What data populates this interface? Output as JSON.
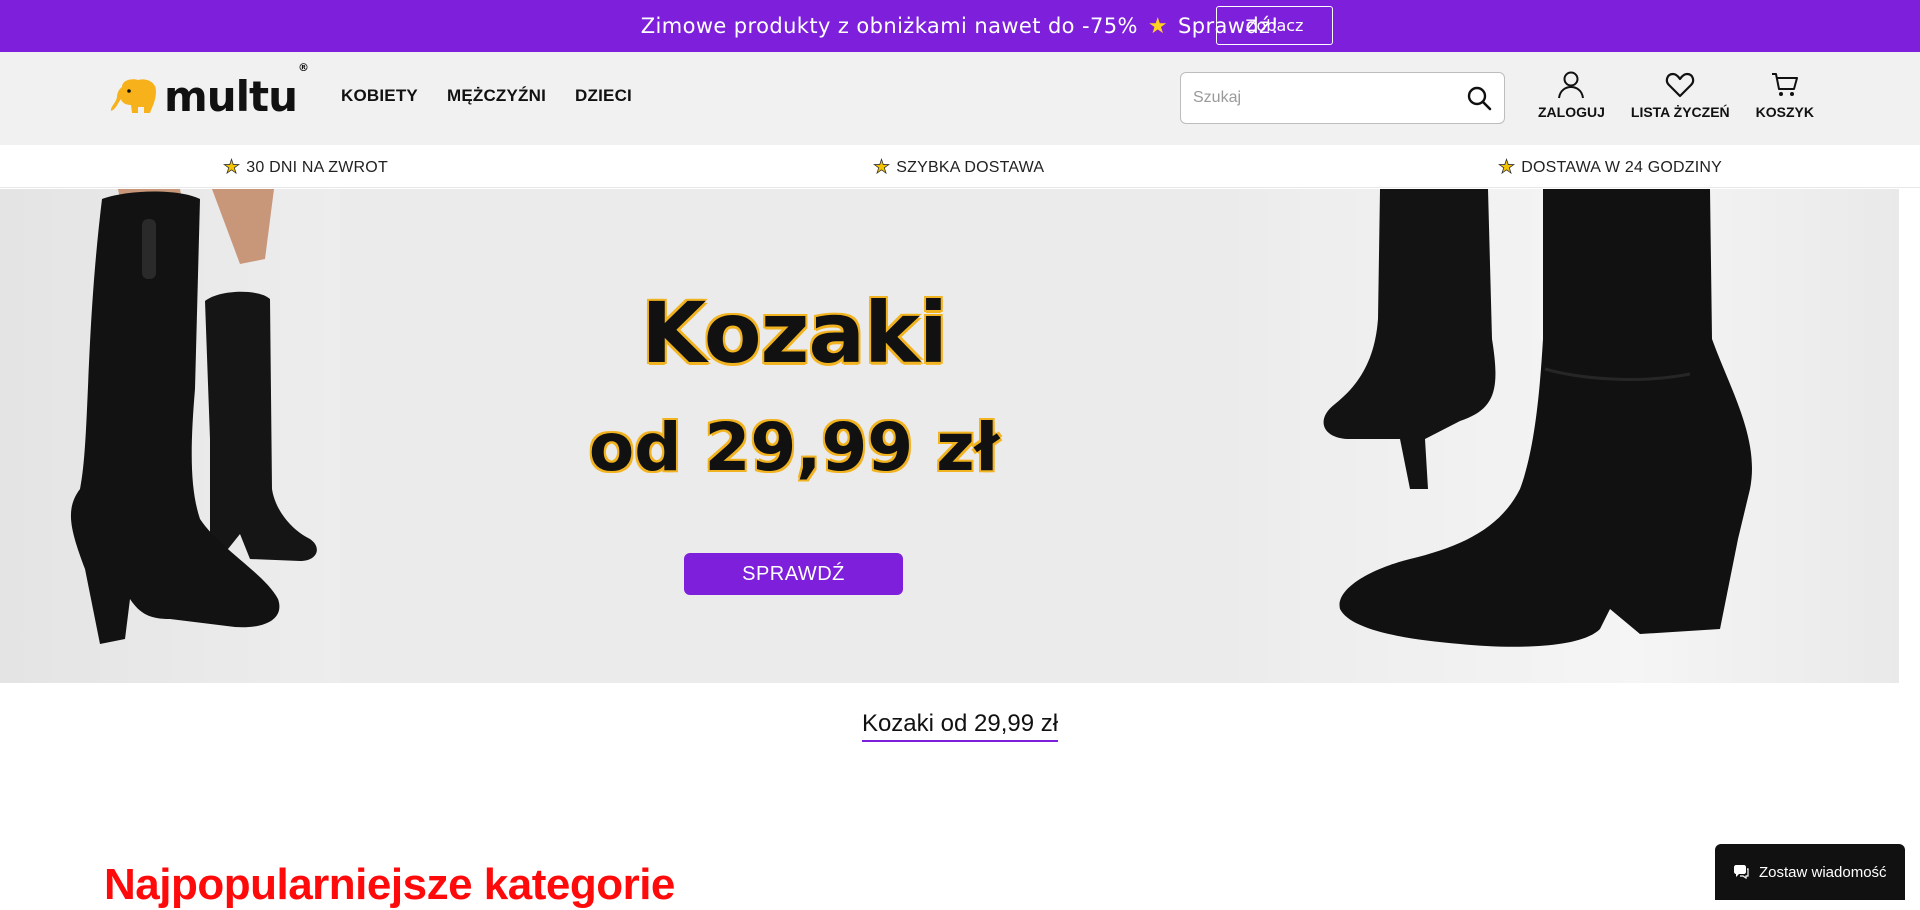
{
  "promo": {
    "text_before": "Zimowe produkty z obniżkami nawet do -75%",
    "text_after": "Sprawdź!",
    "button_label": "Zobacz"
  },
  "header": {
    "logo_text": "multu",
    "logo_mark": "®",
    "nav": [
      "KOBIETY",
      "MĘŻCZYŹNI",
      "DZIECI"
    ],
    "search_placeholder": "Szukaj",
    "actions": {
      "login": "ZALOGUJ",
      "wishlist": "LISTA ŻYCZEŃ",
      "cart": "KOSZYK"
    }
  },
  "usp": [
    "30 DNI NA ZWROT",
    "SZYBKA DOSTAWA",
    "DOSTAWA W 24 GODZINY"
  ],
  "hero": {
    "title": "Kozaki",
    "price": "od 29,99 zł",
    "button_label": "SPRAWDŹ"
  },
  "caption": "Kozaki od 29,99 zł",
  "section_title": "Najpopularniejsze kategorie",
  "chat": {
    "label": "Zostaw wiadomość"
  },
  "colors": {
    "brand_purple": "#7e1fdb",
    "accent_yellow": "#f2b320",
    "heading_red": "#ff0a0a"
  },
  "icons": [
    "star-icon",
    "search-icon",
    "user-icon",
    "heart-icon",
    "cart-icon",
    "chat-bubble-icon",
    "elephant-logo-icon"
  ]
}
